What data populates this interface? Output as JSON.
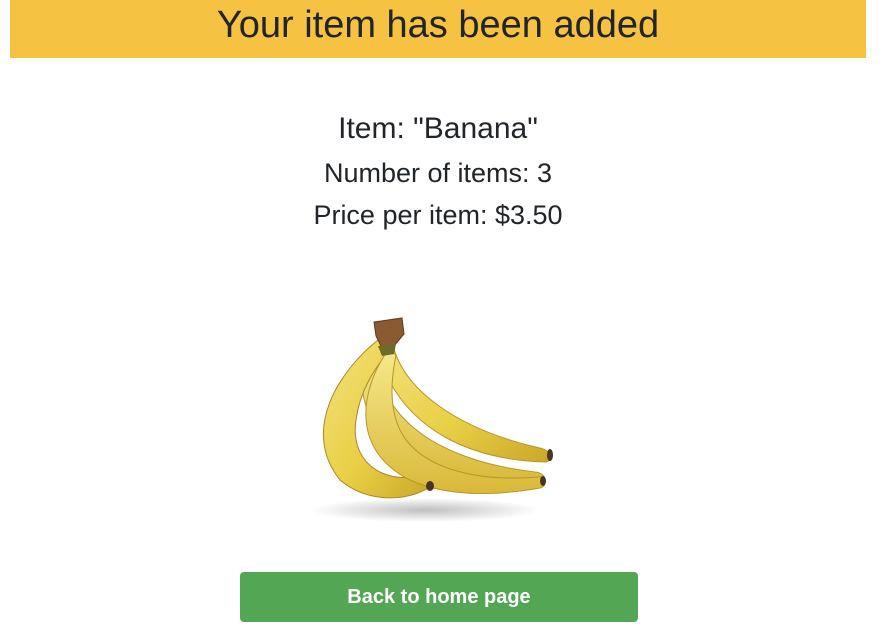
{
  "banner": {
    "message": "Your item has been added",
    "background_color": "#f5c242"
  },
  "item": {
    "name_line": "Item: \"Banana\"",
    "count_line": "Number of items: 3",
    "price_line": "Price per item: $3.50",
    "image_subject": "banana-bunch"
  },
  "actions": {
    "back_label": "Back to home page",
    "button_color": "#53a653"
  }
}
